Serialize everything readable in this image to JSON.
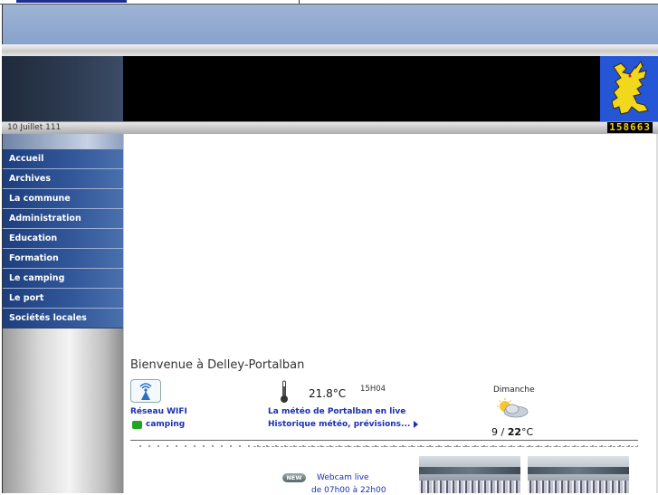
{
  "header": {
    "date": "10 Juillet 111",
    "visitor_counter": "158663"
  },
  "sidebar": {
    "items": [
      {
        "label": "Accueil"
      },
      {
        "label": "Archives"
      },
      {
        "label": "La commune"
      },
      {
        "label": "Administration"
      },
      {
        "label": "Education"
      },
      {
        "label": "Formation"
      },
      {
        "label": "Le camping"
      },
      {
        "label": "Le port"
      },
      {
        "label": "Sociétés locales"
      }
    ]
  },
  "main": {
    "welcome": "Bienvenue à Delley-Portalban",
    "wifi": {
      "label": "Réseau WIFI",
      "camping": "camping",
      "icon": "wifi-icon"
    },
    "weather": {
      "temperature": "21.8°C",
      "time": "15H04",
      "live_link": "La  météo de Portalban en live",
      "history_link": "Historique météo, prévisions...",
      "day": "Dimanche",
      "forecast_low": "9",
      "forecast_sep": " / ",
      "forecast_high": "22",
      "forecast_unit": "°C",
      "icon": "partly-cloudy-icon"
    },
    "webcam": {
      "badge": "NEW",
      "line1": "Webcam live",
      "line2": "de 07h00 à 22h00"
    }
  },
  "colors": {
    "menu_bg": "#2a4c8f",
    "link": "#1a2fb0",
    "counter": "#f0d020",
    "crest_bg": "#2456d6",
    "crest_lion": "#f2d81c"
  }
}
